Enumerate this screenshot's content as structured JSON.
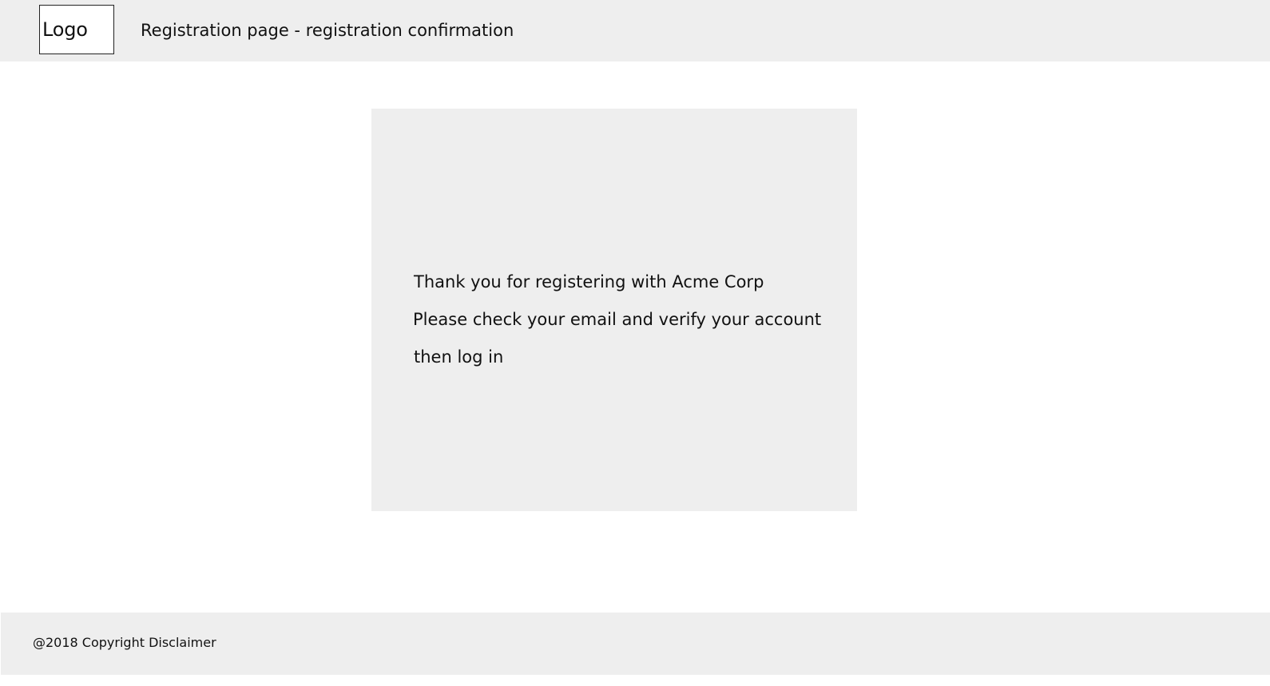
{
  "header": {
    "logo_label": "Logo",
    "title": "Registration page - registration confirmation"
  },
  "confirmation": {
    "line_1": "Thank you for registering with Acme Corp",
    "line_2": "Please check your email and verify your account",
    "line_3": "then log in"
  },
  "footer": {
    "copyright": "@2018 Copyright Disclaimer"
  }
}
